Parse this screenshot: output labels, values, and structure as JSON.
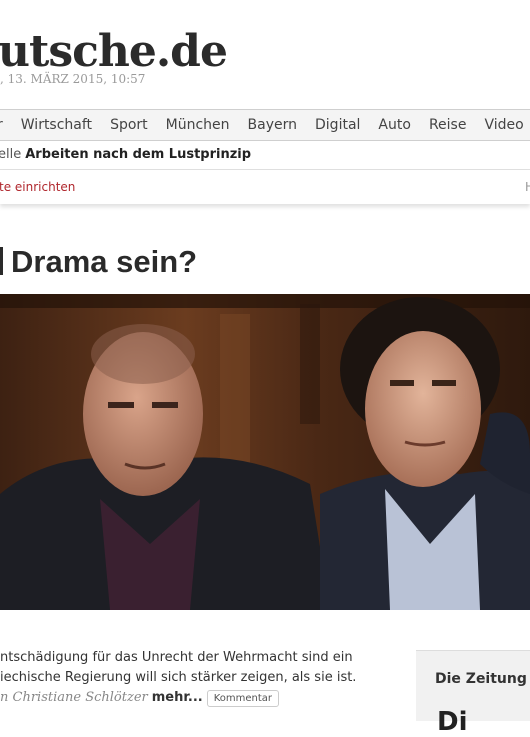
{
  "masthead": {
    "logo": "utsche.de",
    "dateline": ", 13. MÄRZ 2015, 10:57"
  },
  "nav": {
    "items": [
      "r",
      "Wirtschaft",
      "Sport",
      "München",
      "Bayern",
      "Digital",
      "Auto",
      "Reise",
      "Video"
    ]
  },
  "ticker": {
    "prefix": "elle",
    "link": "Arbeiten nach dem Lustprinzip"
  },
  "settings": {
    "link": "te einrichten",
    "right": "H"
  },
  "article": {
    "headline": "Drama sein?",
    "teaser_line1": "ntschädigung für das Unrecht der Wehrmacht sind ein",
    "teaser_line2": "iechische Regierung will sich stärker zeigen, als sie ist.",
    "byline": "n Christiane Schlötzer",
    "more": "mehr...",
    "comment_badge": "Kommentar"
  },
  "sidebar": {
    "title": "Die Zeitung i",
    "glyph": "Di"
  },
  "colors": {
    "accent_red": "#b0272d",
    "photo_wood": "#5a311a",
    "photo_suit": "#1d1e24"
  }
}
